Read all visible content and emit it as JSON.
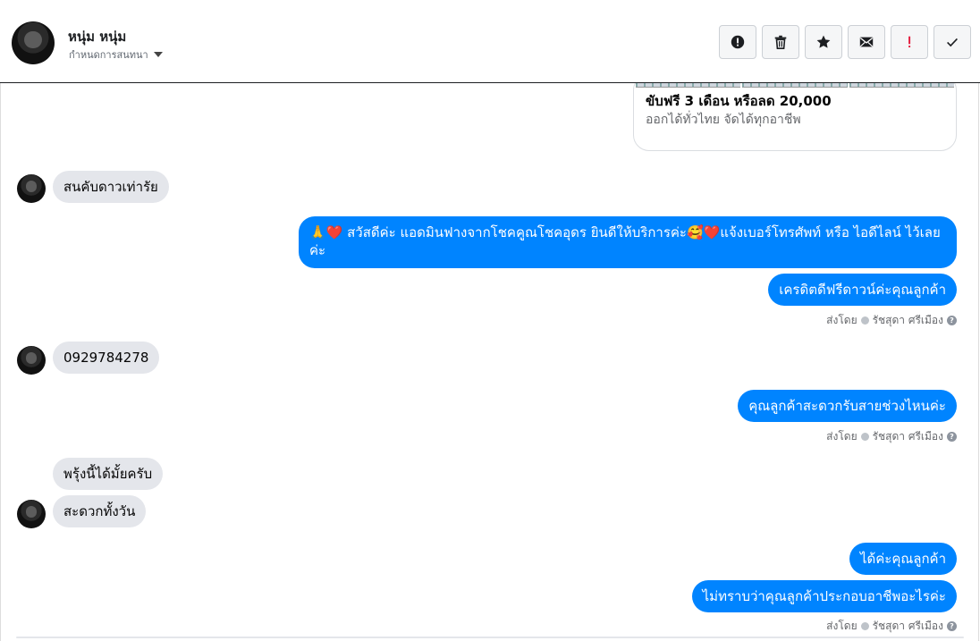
{
  "header": {
    "name": "หนุ่ม หนุ่ม",
    "subtitle": "กำหนดการสนทนา"
  },
  "actions": [
    {
      "icon": "alert-circle-icon"
    },
    {
      "icon": "trash-icon"
    },
    {
      "icon": "star-icon"
    },
    {
      "icon": "mail-icon"
    },
    {
      "icon": "exclamation-icon",
      "color": "#e41e3f"
    },
    {
      "icon": "check-icon"
    }
  ],
  "card": {
    "title": "ขับฟรี 3 เดือน หรือลด 20,000",
    "subtitle": "ออกได้ทั่วไทย จัดได้ทุกอาชีพ"
  },
  "messages": {
    "m1": "สนคับดาวเท่ารัย",
    "m2": "🙏❤️ สวัสดีค่ะ แอดมินฟางจากโชคคูณโชคอุดร ยินดีให้บริการค่ะ🥰❤️แจ้งเบอร์โทรศัพท์ หรือ ไอดีไลน์  ไว้เลยค่ะ",
    "m3": "เครดิตดีฟรีดาวน์ค่ะคุณลูกค้า",
    "meta1": "ส่งโดย",
    "meta1_agent": "รัชสุดา ศรีเมือง",
    "m4": "0929784278",
    "m5": "คุณลูกค้าสะดวกรับสายช่วงไหนค่ะ",
    "meta2": "ส่งโดย",
    "meta2_agent": "รัชสุดา ศรีเมือง",
    "m6": "พรุ้งนี้ได้มั้ยครับ",
    "m7": "สะดวกทั้งวัน",
    "m8": "ได้ค่ะคุณลูกค้า",
    "m9": "ไม่ทราบว่าคุณลูกค้าประกอบอาชีพอะไรค่ะ",
    "meta3": "ส่งโดย",
    "meta3_agent": "รัชสุดา ศรีเมือง"
  },
  "colors": {
    "outgoing": "#0084ff",
    "incoming": "#e4e6eb"
  }
}
